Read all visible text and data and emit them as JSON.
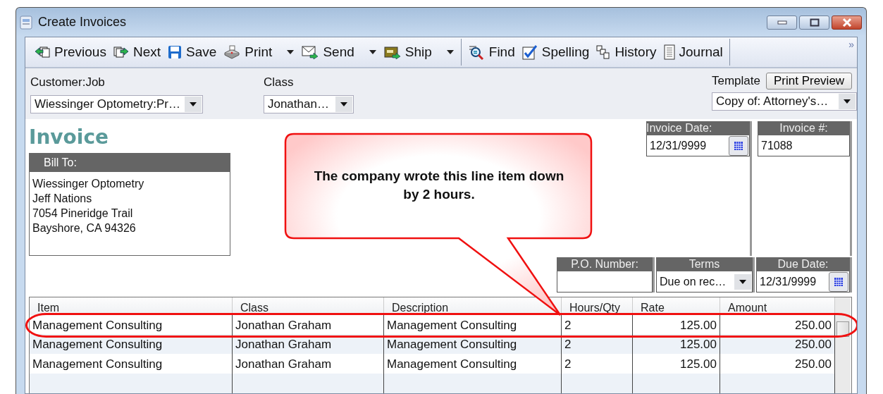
{
  "window": {
    "title": "Create Invoices"
  },
  "toolbar": {
    "groups": [
      [
        {
          "label": "Previous",
          "dropdown": false
        },
        {
          "label": "Next",
          "dropdown": false
        },
        {
          "label": "Save",
          "dropdown": false
        },
        {
          "label": "Print",
          "dropdown": true
        },
        {
          "label": "Send",
          "dropdown": true
        },
        {
          "label": "Ship",
          "dropdown": true
        }
      ],
      [
        {
          "label": "Find",
          "dropdown": false
        },
        {
          "label": "Spelling",
          "dropdown": false
        },
        {
          "label": "History",
          "dropdown": false
        },
        {
          "label": "Journal",
          "dropdown": false
        }
      ]
    ],
    "overflow": "»"
  },
  "header": {
    "customer_job": {
      "label": "Customer:Job",
      "value": "Wiessinger Optometry:Pr…"
    },
    "class": {
      "label": "Class",
      "value": "Jonathan…"
    },
    "template": {
      "label": "Template",
      "value": "Copy of: Attorney's…",
      "button": "Print Preview"
    }
  },
  "invoice": {
    "heading": "Invoice",
    "bill_to": {
      "label": "Bill To:",
      "lines": [
        "Wiessinger Optometry",
        "Jeff Nations",
        "7054 Pineridge Trail",
        "Bayshore, CA 94326"
      ]
    },
    "invoice_date": {
      "label": "Invoice Date:",
      "value": "12/31/9999"
    },
    "invoice_number": {
      "label": "Invoice #:",
      "value": "71088"
    },
    "po_number": {
      "label": "P.O. Number:"
    },
    "terms": {
      "label": "Terms",
      "value": "Due on rec…"
    },
    "due_date": {
      "label": "Due Date:",
      "value": "12/31/9999"
    }
  },
  "table": {
    "columns": [
      "Item",
      "Class",
      "Description",
      "Hours/Qty",
      "Rate",
      "Amount"
    ],
    "rows": [
      {
        "cells": [
          "Management Consulting",
          "Jonathan Graham",
          "Management Consulting",
          "2",
          "125.00",
          "250.00"
        ],
        "circled": true
      },
      {
        "cells": [
          "Management Consulting",
          "Jonathan Graham",
          "Management Consulting",
          "2",
          "125.00",
          "250.00"
        ],
        "circled": false
      },
      {
        "cells": [
          "Management Consulting",
          "Jonathan Graham",
          "Management Consulting",
          "2",
          "125.00",
          "250.00"
        ],
        "circled": false
      }
    ]
  },
  "callout": {
    "text": "The company wrote this line item down by 2 hours."
  }
}
